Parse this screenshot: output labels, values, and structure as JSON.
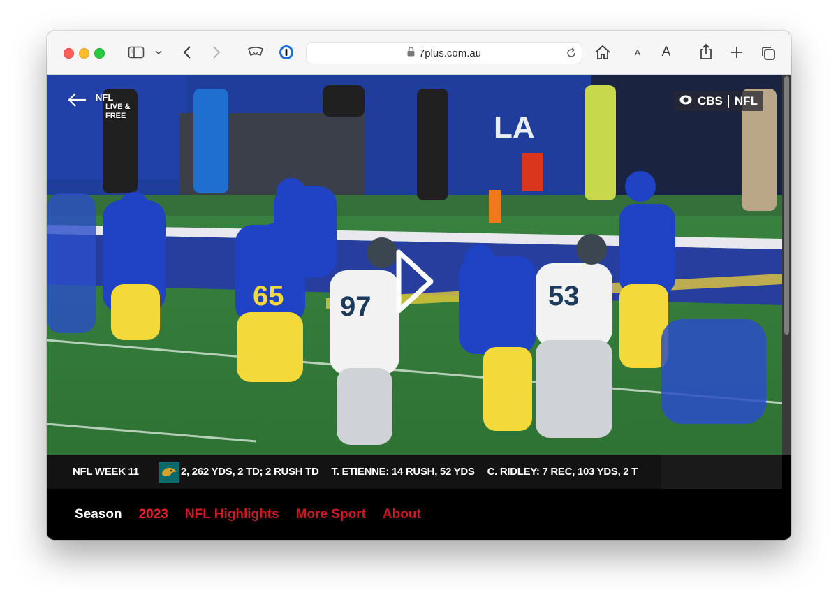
{
  "browser": {
    "url": "7plus.com.au",
    "colors": {
      "close": "#fe5f57",
      "minimize": "#febc2e",
      "maximize": "#28c840"
    },
    "toolbar_icons": [
      "sidebar-icon",
      "chevron-down-icon",
      "back-icon",
      "forward-icon",
      "reader-icon",
      "password-icon",
      "home-icon",
      "text-smaller-icon",
      "text-larger-icon",
      "share-icon",
      "plus-icon",
      "tabs-overview-icon"
    ],
    "text_size_small": "A",
    "text_size_large": "A"
  },
  "video": {
    "live_badge": {
      "league": "NFL",
      "line1": "LIVE &",
      "line2": "FREE"
    },
    "broadcaster": {
      "network": "CBS",
      "league": "NFL"
    },
    "jersey_numbers": [
      "65",
      "97",
      "53"
    ]
  },
  "ticker": {
    "label": "NFL WEEK 11",
    "team_logo": "jaguars-logo",
    "stats": [
      "2, 262 YDS, 2 TD; 2 RUSH TD",
      "T. ETIENNE: 14 RUSH, 52 YDS",
      "C. RIDLEY: 7 REC, 103 YDS, 2 T"
    ]
  },
  "nav": {
    "season_label": "Season",
    "year": "2023",
    "items": [
      "NFL Highlights",
      "More Sport",
      "About"
    ],
    "colors": {
      "active": "#e8202a",
      "link": "#cc1a25"
    }
  }
}
